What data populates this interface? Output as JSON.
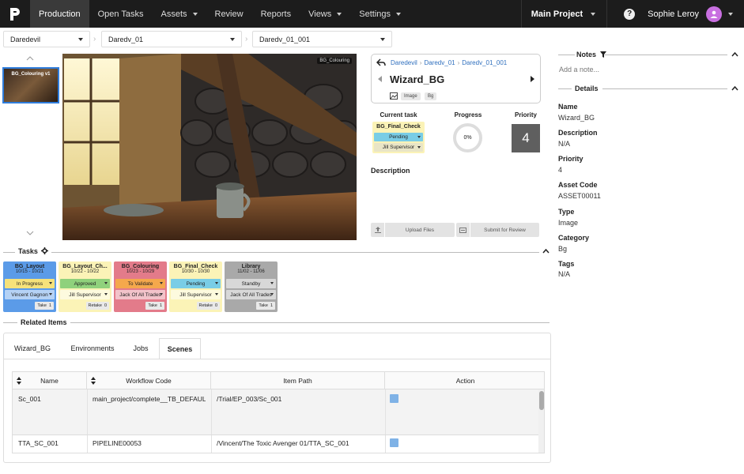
{
  "nav": {
    "items": [
      {
        "label": "Production",
        "active": true
      },
      {
        "label": "Open Tasks"
      },
      {
        "label": "Assets",
        "dropdown": true
      },
      {
        "label": "Review"
      },
      {
        "label": "Reports"
      },
      {
        "label": "Views",
        "dropdown": true
      },
      {
        "label": "Settings",
        "dropdown": true
      }
    ],
    "project": "Main Project",
    "user": "Sophie Leroy",
    "help": "?"
  },
  "breadcrumb": {
    "project": "Daredevil",
    "episode": "Daredv_01",
    "shot": "Daredv_01_001"
  },
  "thumbnail": {
    "label": "BG_Colouring v1"
  },
  "viewer": {
    "tag": "BG_Colouring"
  },
  "asset": {
    "crumbs": [
      "Daredevil",
      "Daredv_01",
      "Daredv_01_001"
    ],
    "name": "Wizard_BG",
    "tags": [
      "Image",
      "Bg"
    ]
  },
  "current_task": {
    "heading": "Current task",
    "name": "BG_Final_Check",
    "status": "Pending",
    "assignee": "Jill Supervisor"
  },
  "progress": {
    "heading": "Progress",
    "value": "0%"
  },
  "priority": {
    "heading": "Priority",
    "value": "4"
  },
  "description": {
    "heading": "Description"
  },
  "buttons": {
    "upload": "Upload Files",
    "submit": "Submit for Review"
  },
  "tasks_section": {
    "title": "Tasks"
  },
  "tasks": [
    {
      "name": "BG_Layout",
      "dates": "10/15 - 10/21",
      "status": "In Progress",
      "assignee": "Vincent Gagnon",
      "foot_label": "Take",
      "foot_count": "1",
      "bg": "#5b9be8",
      "status_bg": "#f6e27a"
    },
    {
      "name": "BG_Layout_Ch...",
      "dates": "10/22 - 10/22",
      "status": "Approved",
      "assignee": "Jill Supervisor",
      "foot_label": "Retake",
      "foot_count": "0",
      "bg": "#fbf3b7",
      "status_bg": "#8fd17c"
    },
    {
      "name": "BG_Colouring",
      "dates": "10/23 - 10/29",
      "status": "To Validate",
      "assignee": "Jack Of All Trades",
      "foot_label": "Take",
      "foot_count": "1",
      "bg": "#e37b8a",
      "status_bg": "#f5a84c"
    },
    {
      "name": "BG_Final_Check",
      "dates": "10/30 - 10/30",
      "status": "Pending",
      "assignee": "Jill Supervisor",
      "foot_label": "Retake",
      "foot_count": "0",
      "bg": "#fbf3b7",
      "status_bg": "#79cde6"
    },
    {
      "name": "Library",
      "dates": "11/02 - 11/06",
      "status": "Standby",
      "assignee": "Jack Of All Trades",
      "foot_label": "Take",
      "foot_count": "1",
      "bg": "#a9a9a9",
      "status_bg": "#d8d8d8"
    }
  ],
  "related": {
    "title": "Related Items",
    "tabs": [
      "Wizard_BG",
      "Environments",
      "Jobs",
      "Scenes"
    ],
    "selected_tab": "Scenes",
    "columns": [
      "Name",
      "Workflow Code",
      "Item Path",
      "Action"
    ],
    "rows": [
      {
        "name": "Sc_001",
        "workflow": "main_project/complete__TB_DEFAUL",
        "path": "/Trial/EP_003/Sc_001"
      },
      {
        "name": "TTA_SC_001",
        "workflow": "PIPELINE00053",
        "path": "/Vincent/The Toxic Avenger 01/TTA_SC_001"
      }
    ]
  },
  "notes": {
    "title": "Notes",
    "placeholder": "Add a note..."
  },
  "details": {
    "title": "Details",
    "fields": [
      {
        "label": "Name",
        "value": "Wizard_BG"
      },
      {
        "label": "Description",
        "value": "N/A"
      },
      {
        "label": "Priority",
        "value": "4"
      },
      {
        "label": "Asset Code",
        "value": "ASSET00011"
      },
      {
        "label": "Type",
        "value": "Image"
      },
      {
        "label": "Category",
        "value": "Bg"
      },
      {
        "label": "Tags",
        "value": "N/A"
      }
    ]
  },
  "colors": {
    "accent": "#2f7ddc",
    "topbar": "#1c1c1c",
    "link": "#2f6fbe"
  }
}
